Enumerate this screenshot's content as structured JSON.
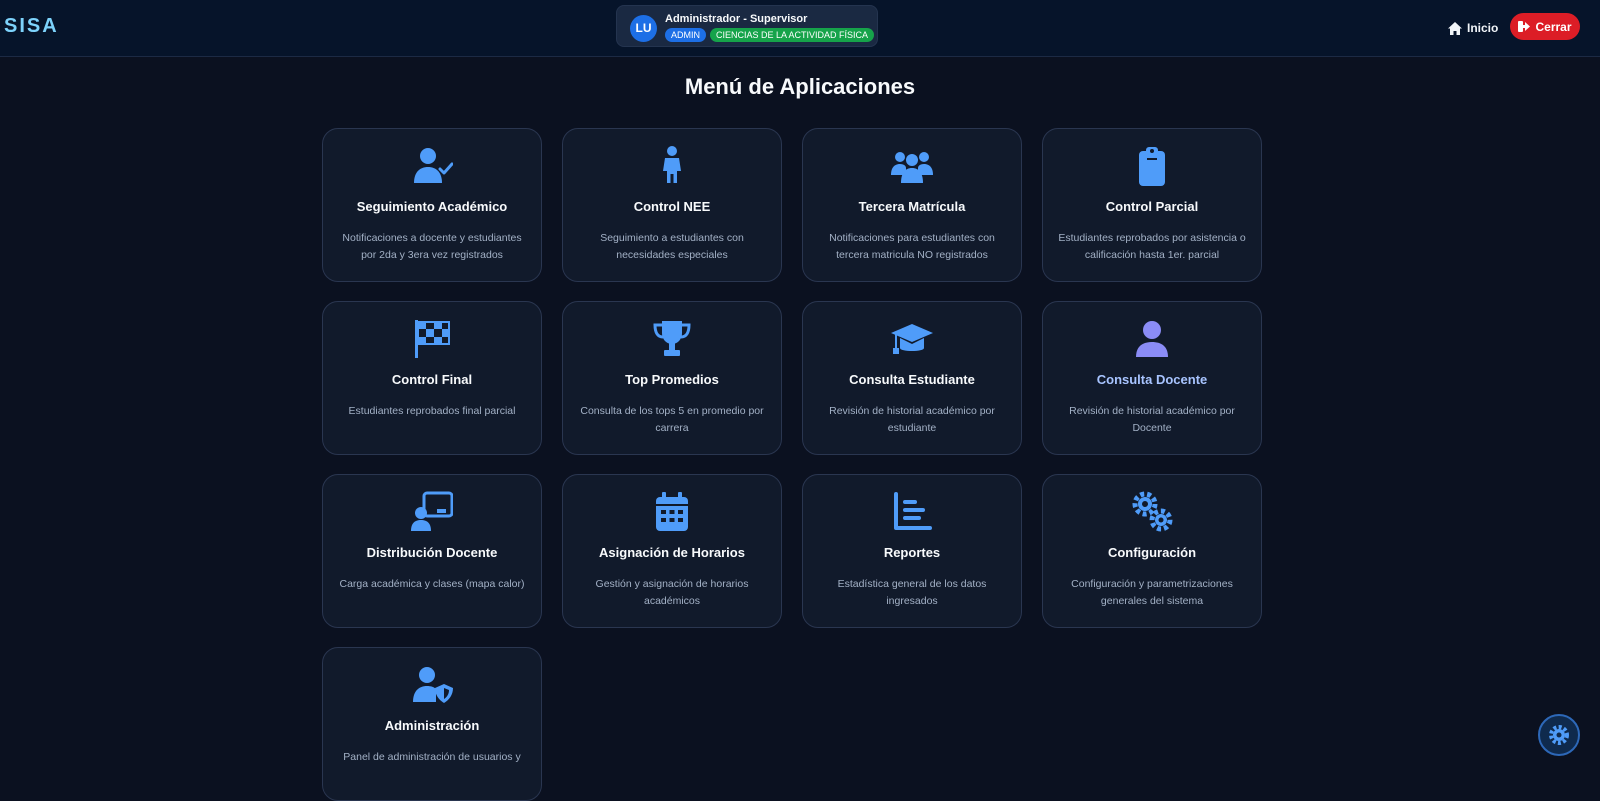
{
  "header": {
    "brand": "SISA",
    "user": {
      "initials": "LU",
      "name": "Administrador - Supervisor",
      "role_badge": "ADMIN",
      "faculty_badge": "CIENCIAS DE LA ACTIVIDAD FÍSICA"
    },
    "home_label": "Inicio",
    "logout_label": "Cerrar"
  },
  "page_title": "Menú de Aplicaciones",
  "colors": {
    "accent": "#4f9cf9",
    "highlight_icon": "#8b8cf6",
    "logout": "#dc1d26",
    "badge_admin": "#1d6fe6",
    "badge_faculty": "#16a34a"
  },
  "cards": [
    {
      "icon": "user-check-icon",
      "title": "Seguimiento Académico",
      "description": "Notificaciones a docente y estudiantes por 2da y 3era vez registrados"
    },
    {
      "icon": "child-icon",
      "title": "Control NEE",
      "description": "Seguimiento a estudiantes con necesidades especiales"
    },
    {
      "icon": "users-icon",
      "title": "Tercera Matrícula",
      "description": "Notificaciones para estudiantes con tercera matricula NO registrados"
    },
    {
      "icon": "clipboard-icon",
      "title": "Control Parcial",
      "description": "Estudiantes reprobados por asistencia o calificación hasta 1er. parcial"
    },
    {
      "icon": "flag-checkered-icon",
      "title": "Control Final",
      "description": "Estudiantes reprobados final parcial"
    },
    {
      "icon": "trophy-icon",
      "title": "Top Promedios",
      "description": "Consulta de los tops 5 en promedio por carrera"
    },
    {
      "icon": "graduation-cap-icon",
      "title": "Consulta Estudiante",
      "description": "Revisión de historial académico por estudiante"
    },
    {
      "icon": "user-icon",
      "title": "Consulta Docente",
      "description": "Revisión de historial académico por Docente"
    },
    {
      "icon": "chalkboard-teacher-icon",
      "title": "Distribución Docente",
      "description": "Carga académica y clases (mapa calor)"
    },
    {
      "icon": "calendar-icon",
      "title": "Asignación de Horarios",
      "description": "Gestión y asignación de horarios académicos"
    },
    {
      "icon": "chart-bar-icon",
      "title": "Reportes",
      "description": "Estadística general de los datos ingresados"
    },
    {
      "icon": "gears-icon",
      "title": "Configuración",
      "description": "Configuración y parametrizaciones generales del sistema"
    },
    {
      "icon": "user-shield-icon",
      "title": "Administración",
      "description": "Panel de administración de usuarios y"
    }
  ],
  "floating_button_icon": "gear-icon"
}
